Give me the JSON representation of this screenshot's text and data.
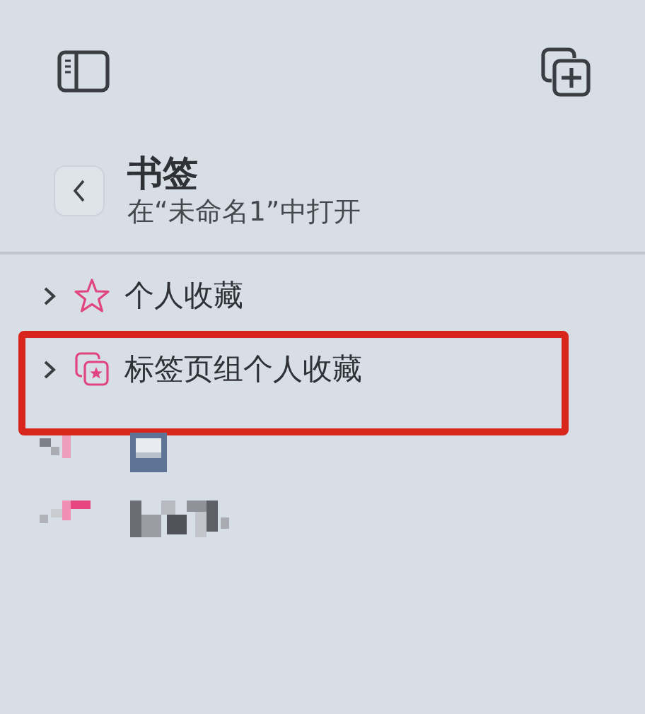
{
  "header": {
    "title": "书签",
    "subtitle": "在“未命名1”中打开"
  },
  "items": [
    {
      "kind": "favorites",
      "label": "个人收藏",
      "expanded": false,
      "highlighted": false
    },
    {
      "kind": "tab-group",
      "label": "标签页组个人收藏",
      "expanded": false,
      "highlighted": true
    }
  ],
  "redacted_rows": [
    {
      "kind": "mosaic-square"
    },
    {
      "kind": "mosaic-text"
    }
  ]
}
